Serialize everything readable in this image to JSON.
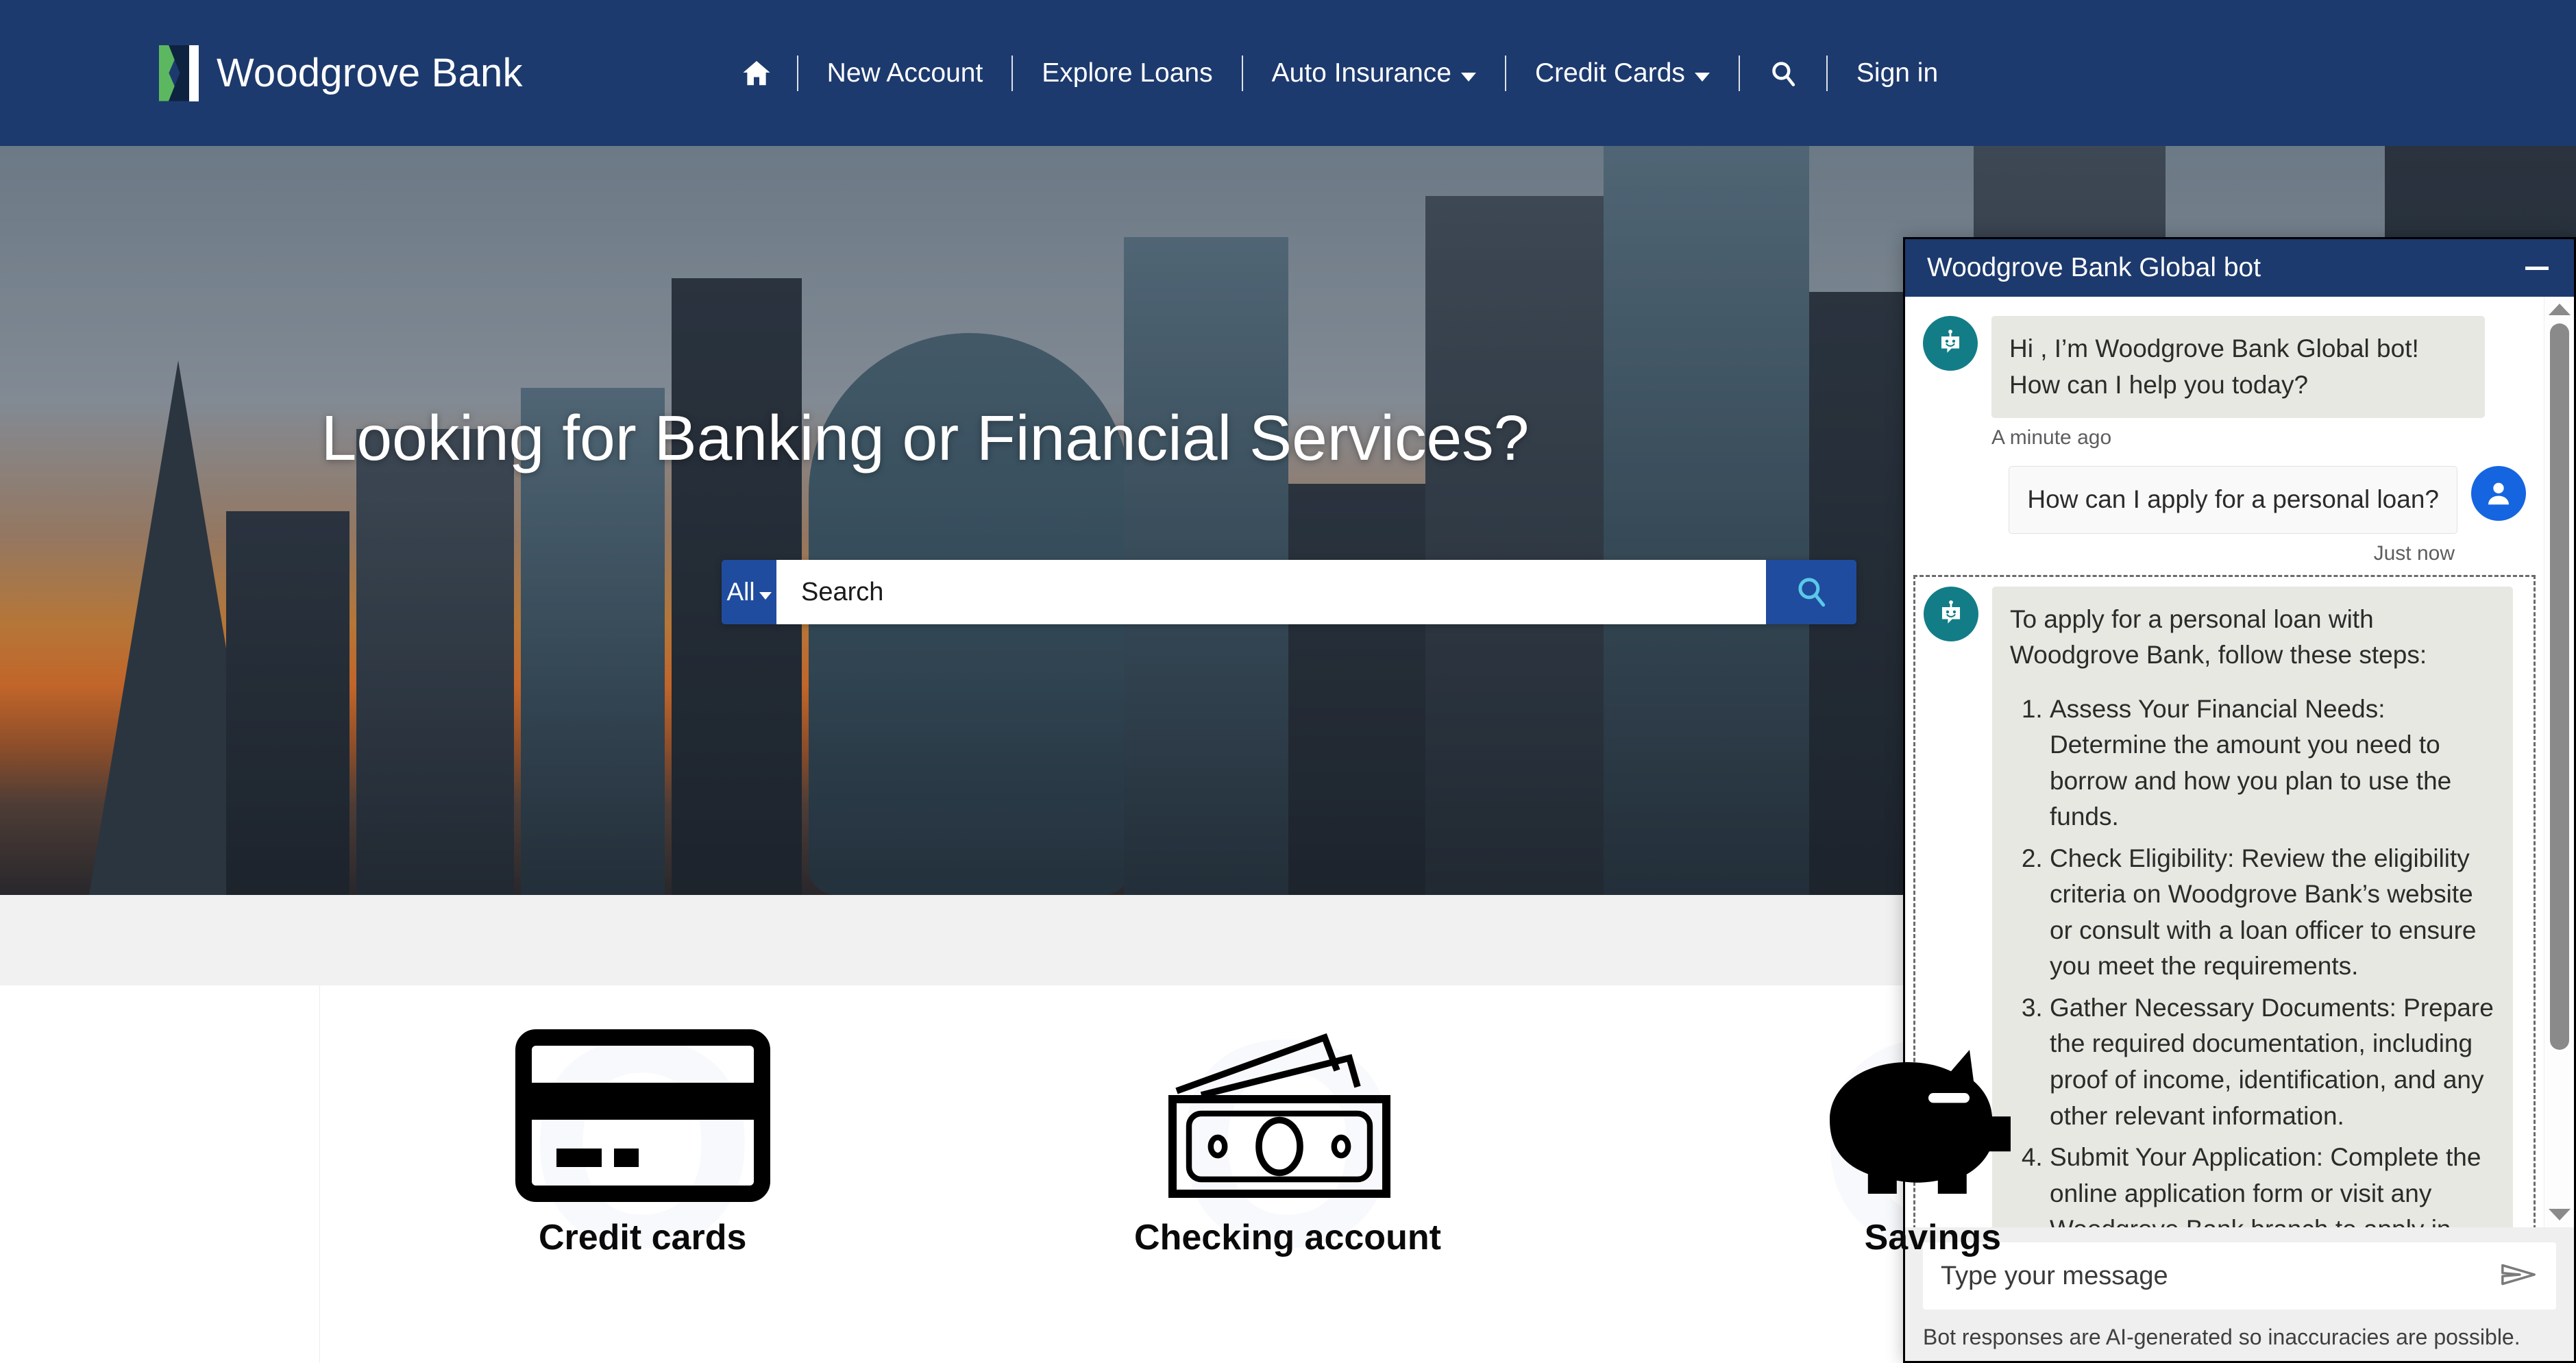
{
  "nav": {
    "brand": "Woodgrove Bank",
    "home_icon": "home-icon",
    "items": [
      {
        "label": "New Account",
        "has_caret": false
      },
      {
        "label": "Explore Loans",
        "has_caret": false
      },
      {
        "label": "Auto Insurance",
        "has_caret": true
      },
      {
        "label": "Credit Cards",
        "has_caret": true
      }
    ],
    "search_icon": "search-icon",
    "signin": "Sign in"
  },
  "hero": {
    "title": "Looking for Banking or Financial Services?"
  },
  "search": {
    "scope_label": "All",
    "placeholder": "Search",
    "value": "",
    "button_icon": "search-icon"
  },
  "products": [
    {
      "label": "Credit cards",
      "icon": "credit-card-icon",
      "watermark": "O"
    },
    {
      "label": "Checking account",
      "icon": "banknotes-icon",
      "watermark": "O"
    },
    {
      "label": "Savings",
      "icon": "piggy-bank-icon",
      "watermark": "O"
    }
  ],
  "chat": {
    "title": "Woodgrove Bank Global bot",
    "minimize_icon": "minimize-icon",
    "messages": [
      {
        "from": "bot",
        "text": "Hi , I’m Woodgrove Bank Global bot! How can I help you today?",
        "timestamp": "A minute ago"
      },
      {
        "from": "user",
        "text": "How can I apply for a personal loan?",
        "timestamp": "Just now"
      }
    ],
    "answer": {
      "intro": "To apply for a personal loan with Woodgrove Bank, follow these steps:",
      "steps": [
        "Assess Your Financial Needs: Determine the amount you need to borrow and how you plan to use the funds.",
        "Check Eligibility: Review the eligibility criteria on Woodgrove Bank’s website or consult with a loan officer to ensure you meet the requirements.",
        "Gather Necessary Documents: Prepare the required documentation, including proof of income, identification, and any other relevant information.",
        "Submit Your Application: Complete the online application form or visit any Woodgrove Bank branch to apply in"
      ]
    },
    "input_placeholder": "Type your message",
    "input_value": "",
    "send_icon": "send-icon",
    "disclaimer": "Bot responses are AI-generated so inaccuracies are possible.",
    "scrollbar": {
      "up_icon": "chevron-up-icon",
      "down_icon": "chevron-down-icon"
    }
  },
  "colors": {
    "brand_navy": "#1d3a6e",
    "brand_green": "#5cb860",
    "accent_blue": "#1f4c9e",
    "bot_avatar": "#127d87",
    "user_avatar": "#1565e0",
    "bot_bubble": "#e7e8e1"
  }
}
